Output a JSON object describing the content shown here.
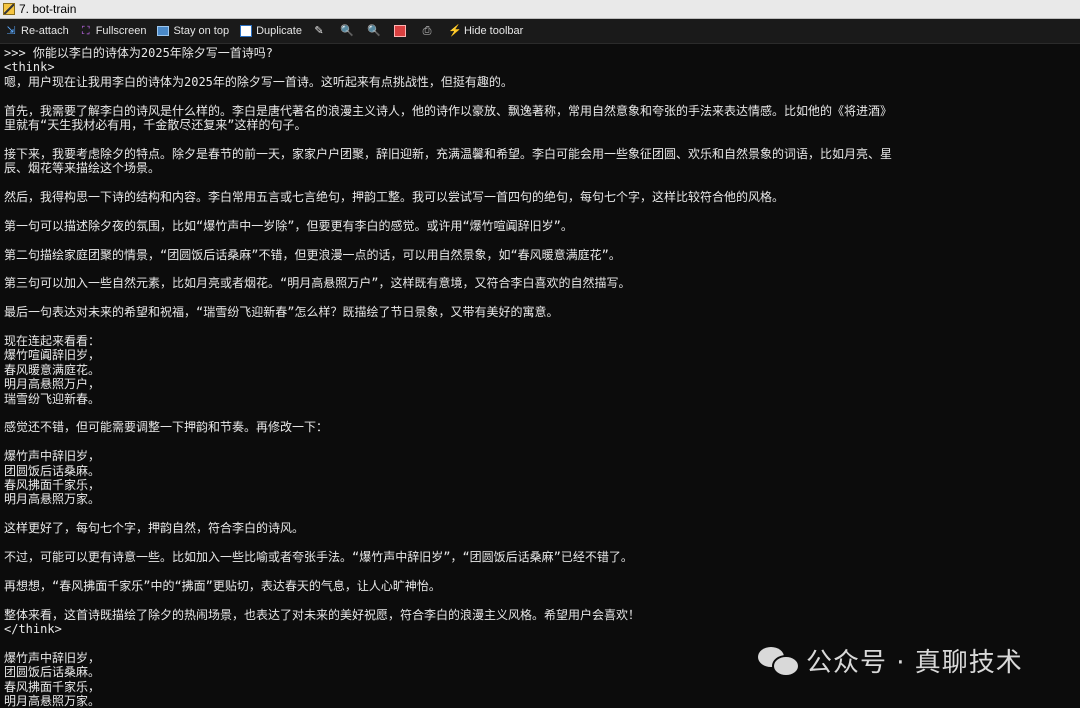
{
  "window": {
    "title": "7. bot-train"
  },
  "toolbar": {
    "items": [
      {
        "label": "Re-attach",
        "icon": "reattach-icon"
      },
      {
        "label": "Fullscreen",
        "icon": "fullscreen-icon"
      },
      {
        "label": "Stay on top",
        "icon": "stay-on-top-icon"
      },
      {
        "label": "Duplicate",
        "icon": "duplicate-icon"
      },
      {
        "label": "",
        "icon": "edit-icon"
      },
      {
        "label": "",
        "icon": "zoom-in-icon"
      },
      {
        "label": "",
        "icon": "zoom-out-icon"
      },
      {
        "label": "",
        "icon": "save-icon"
      },
      {
        "label": "",
        "icon": "print-icon"
      },
      {
        "label": "Hide toolbar",
        "icon": "hide-toolbar-icon"
      }
    ]
  },
  "terminal": {
    "lines": [
      ">>> 你能以李白的诗体为2025年除夕写一首诗吗?",
      "<think>",
      "嗯，用户现在让我用李白的诗体为2025年的除夕写一首诗。这听起来有点挑战性，但挺有趣的。",
      "",
      "首先，我需要了解李白的诗风是什么样的。李白是唐代著名的浪漫主义诗人，他的诗作以豪放、飘逸著称，常用自然意象和夸张的手法来表达情感。比如他的《将进酒》",
      "里就有“天生我材必有用，千金散尽还复来”这样的句子。",
      "",
      "接下来，我要考虑除夕的特点。除夕是春节的前一天，家家户户团聚，辞旧迎新，充满温馨和希望。李白可能会用一些象征团圆、欢乐和自然景象的词语，比如月亮、星",
      "辰、烟花等来描绘这个场景。",
      "",
      "然后，我得构思一下诗的结构和内容。李白常用五言或七言绝句，押韵工整。我可以尝试写一首四句的绝句，每句七个字，这样比较符合他的风格。",
      "",
      "第一句可以描述除夕夜的氛围，比如“爆竹声中一岁除”，但要更有李白的感觉。或许用“爆竹喧阗辞旧岁”。",
      "",
      "第二句描绘家庭团聚的情景，“团圆饭后话桑麻”不错，但更浪漫一点的话，可以用自然景象，如“春风暖意满庭花”。",
      "",
      "第三句可以加入一些自然元素，比如月亮或者烟花。“明月高悬照万户”，这样既有意境，又符合李白喜欢的自然描写。",
      "",
      "最后一句表达对未来的希望和祝福，“瑞雪纷飞迎新春”怎么样？既描绘了节日景象，又带有美好的寓意。",
      "",
      "现在连起来看看：",
      "爆竹喧阗辞旧岁，",
      "春风暖意满庭花。",
      "明月高悬照万户，",
      "瑞雪纷飞迎新春。",
      "",
      "感觉还不错，但可能需要调整一下押韵和节奏。再修改一下：",
      "",
      "爆竹声中辞旧岁，",
      "团圆饭后话桑麻。",
      "春风拂面千家乐，",
      "明月高悬照万家。",
      "",
      "这样更好了，每句七个字，押韵自然，符合李白的诗风。",
      "",
      "不过，可能可以更有诗意一些。比如加入一些比喻或者夸张手法。“爆竹声中辞旧岁”，“团圆饭后话桑麻”已经不错了。",
      "",
      "再想想，“春风拂面千家乐”中的“拂面”更贴切，表达春天的气息，让人心旷神怡。",
      "",
      "整体来看，这首诗既描绘了除夕的热闹场景，也表达了对未来的美好祝愿，符合李白的浪漫主义风格。希望用户会喜欢！",
      "</think>",
      "",
      "爆竹声中辞旧岁，",
      "团圆饭后话桑麻。",
      "春风拂面千家乐，",
      "明月高悬照万家。"
    ]
  },
  "watermark": {
    "text": "公众号 · 真聊技术",
    "icon": "wechat-logo-icon"
  }
}
